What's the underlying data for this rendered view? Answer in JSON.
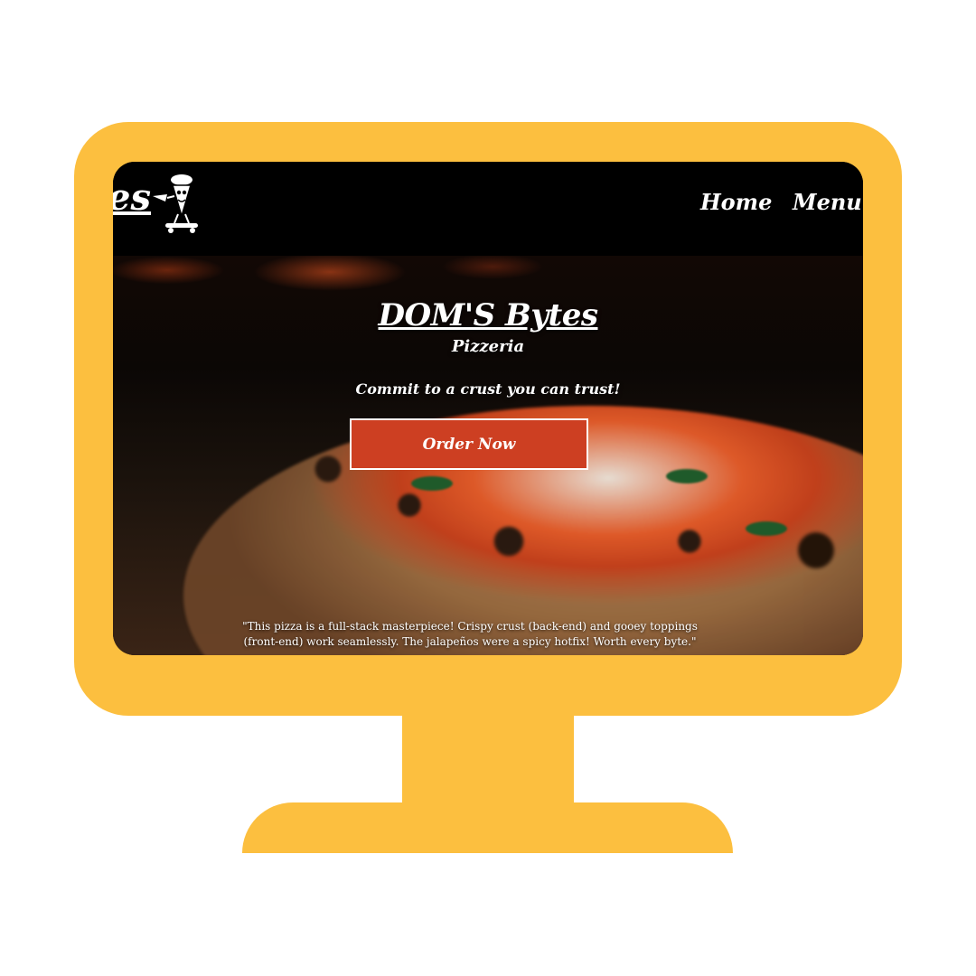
{
  "site": {
    "logo_text": "es"
  },
  "nav": {
    "home_label": "Home",
    "menu_label": "Menu"
  },
  "hero": {
    "title": "DOM'S Bytes",
    "subtitle": "Pizzeria",
    "tagline": "Commit to a crust you can trust!",
    "cta_label": "Order Now"
  },
  "testimonial": {
    "line1": "\"This pizza is a full-stack masterpiece! Crispy crust (back-end) and gooey toppings",
    "line2": "(front-end) work seamlessly. The jalapeños were a spicy hotfix! Worth every byte.\""
  },
  "colors": {
    "monitor": "#fcbf3f",
    "cta_background": "#cd3f22",
    "navbar": "#000000"
  },
  "icons": {
    "mascot": "pizza-mascot-skateboard-icon"
  }
}
